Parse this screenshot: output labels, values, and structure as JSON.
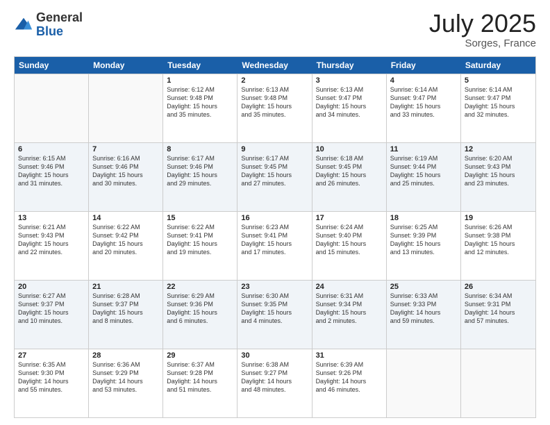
{
  "logo": {
    "general": "General",
    "blue": "Blue"
  },
  "title": "July 2025",
  "location": "Sorges, France",
  "header_days": [
    "Sunday",
    "Monday",
    "Tuesday",
    "Wednesday",
    "Thursday",
    "Friday",
    "Saturday"
  ],
  "rows": [
    [
      {
        "day": "",
        "empty": true
      },
      {
        "day": "",
        "empty": true
      },
      {
        "day": "1",
        "line1": "Sunrise: 6:12 AM",
        "line2": "Sunset: 9:48 PM",
        "line3": "Daylight: 15 hours",
        "line4": "and 35 minutes."
      },
      {
        "day": "2",
        "line1": "Sunrise: 6:13 AM",
        "line2": "Sunset: 9:48 PM",
        "line3": "Daylight: 15 hours",
        "line4": "and 35 minutes."
      },
      {
        "day": "3",
        "line1": "Sunrise: 6:13 AM",
        "line2": "Sunset: 9:47 PM",
        "line3": "Daylight: 15 hours",
        "line4": "and 34 minutes."
      },
      {
        "day": "4",
        "line1": "Sunrise: 6:14 AM",
        "line2": "Sunset: 9:47 PM",
        "line3": "Daylight: 15 hours",
        "line4": "and 33 minutes."
      },
      {
        "day": "5",
        "line1": "Sunrise: 6:14 AM",
        "line2": "Sunset: 9:47 PM",
        "line3": "Daylight: 15 hours",
        "line4": "and 32 minutes."
      }
    ],
    [
      {
        "day": "6",
        "line1": "Sunrise: 6:15 AM",
        "line2": "Sunset: 9:46 PM",
        "line3": "Daylight: 15 hours",
        "line4": "and 31 minutes."
      },
      {
        "day": "7",
        "line1": "Sunrise: 6:16 AM",
        "line2": "Sunset: 9:46 PM",
        "line3": "Daylight: 15 hours",
        "line4": "and 30 minutes."
      },
      {
        "day": "8",
        "line1": "Sunrise: 6:17 AM",
        "line2": "Sunset: 9:46 PM",
        "line3": "Daylight: 15 hours",
        "line4": "and 29 minutes."
      },
      {
        "day": "9",
        "line1": "Sunrise: 6:17 AM",
        "line2": "Sunset: 9:45 PM",
        "line3": "Daylight: 15 hours",
        "line4": "and 27 minutes."
      },
      {
        "day": "10",
        "line1": "Sunrise: 6:18 AM",
        "line2": "Sunset: 9:45 PM",
        "line3": "Daylight: 15 hours",
        "line4": "and 26 minutes."
      },
      {
        "day": "11",
        "line1": "Sunrise: 6:19 AM",
        "line2": "Sunset: 9:44 PM",
        "line3": "Daylight: 15 hours",
        "line4": "and 25 minutes."
      },
      {
        "day": "12",
        "line1": "Sunrise: 6:20 AM",
        "line2": "Sunset: 9:43 PM",
        "line3": "Daylight: 15 hours",
        "line4": "and 23 minutes."
      }
    ],
    [
      {
        "day": "13",
        "line1": "Sunrise: 6:21 AM",
        "line2": "Sunset: 9:43 PM",
        "line3": "Daylight: 15 hours",
        "line4": "and 22 minutes."
      },
      {
        "day": "14",
        "line1": "Sunrise: 6:22 AM",
        "line2": "Sunset: 9:42 PM",
        "line3": "Daylight: 15 hours",
        "line4": "and 20 minutes."
      },
      {
        "day": "15",
        "line1": "Sunrise: 6:22 AM",
        "line2": "Sunset: 9:41 PM",
        "line3": "Daylight: 15 hours",
        "line4": "and 19 minutes."
      },
      {
        "day": "16",
        "line1": "Sunrise: 6:23 AM",
        "line2": "Sunset: 9:41 PM",
        "line3": "Daylight: 15 hours",
        "line4": "and 17 minutes."
      },
      {
        "day": "17",
        "line1": "Sunrise: 6:24 AM",
        "line2": "Sunset: 9:40 PM",
        "line3": "Daylight: 15 hours",
        "line4": "and 15 minutes."
      },
      {
        "day": "18",
        "line1": "Sunrise: 6:25 AM",
        "line2": "Sunset: 9:39 PM",
        "line3": "Daylight: 15 hours",
        "line4": "and 13 minutes."
      },
      {
        "day": "19",
        "line1": "Sunrise: 6:26 AM",
        "line2": "Sunset: 9:38 PM",
        "line3": "Daylight: 15 hours",
        "line4": "and 12 minutes."
      }
    ],
    [
      {
        "day": "20",
        "line1": "Sunrise: 6:27 AM",
        "line2": "Sunset: 9:37 PM",
        "line3": "Daylight: 15 hours",
        "line4": "and 10 minutes."
      },
      {
        "day": "21",
        "line1": "Sunrise: 6:28 AM",
        "line2": "Sunset: 9:37 PM",
        "line3": "Daylight: 15 hours",
        "line4": "and 8 minutes."
      },
      {
        "day": "22",
        "line1": "Sunrise: 6:29 AM",
        "line2": "Sunset: 9:36 PM",
        "line3": "Daylight: 15 hours",
        "line4": "and 6 minutes."
      },
      {
        "day": "23",
        "line1": "Sunrise: 6:30 AM",
        "line2": "Sunset: 9:35 PM",
        "line3": "Daylight: 15 hours",
        "line4": "and 4 minutes."
      },
      {
        "day": "24",
        "line1": "Sunrise: 6:31 AM",
        "line2": "Sunset: 9:34 PM",
        "line3": "Daylight: 15 hours",
        "line4": "and 2 minutes."
      },
      {
        "day": "25",
        "line1": "Sunrise: 6:33 AM",
        "line2": "Sunset: 9:33 PM",
        "line3": "Daylight: 14 hours",
        "line4": "and 59 minutes."
      },
      {
        "day": "26",
        "line1": "Sunrise: 6:34 AM",
        "line2": "Sunset: 9:31 PM",
        "line3": "Daylight: 14 hours",
        "line4": "and 57 minutes."
      }
    ],
    [
      {
        "day": "27",
        "line1": "Sunrise: 6:35 AM",
        "line2": "Sunset: 9:30 PM",
        "line3": "Daylight: 14 hours",
        "line4": "and 55 minutes."
      },
      {
        "day": "28",
        "line1": "Sunrise: 6:36 AM",
        "line2": "Sunset: 9:29 PM",
        "line3": "Daylight: 14 hours",
        "line4": "and 53 minutes."
      },
      {
        "day": "29",
        "line1": "Sunrise: 6:37 AM",
        "line2": "Sunset: 9:28 PM",
        "line3": "Daylight: 14 hours",
        "line4": "and 51 minutes."
      },
      {
        "day": "30",
        "line1": "Sunrise: 6:38 AM",
        "line2": "Sunset: 9:27 PM",
        "line3": "Daylight: 14 hours",
        "line4": "and 48 minutes."
      },
      {
        "day": "31",
        "line1": "Sunrise: 6:39 AM",
        "line2": "Sunset: 9:26 PM",
        "line3": "Daylight: 14 hours",
        "line4": "and 46 minutes."
      },
      {
        "day": "",
        "empty": true
      },
      {
        "day": "",
        "empty": true
      }
    ]
  ]
}
